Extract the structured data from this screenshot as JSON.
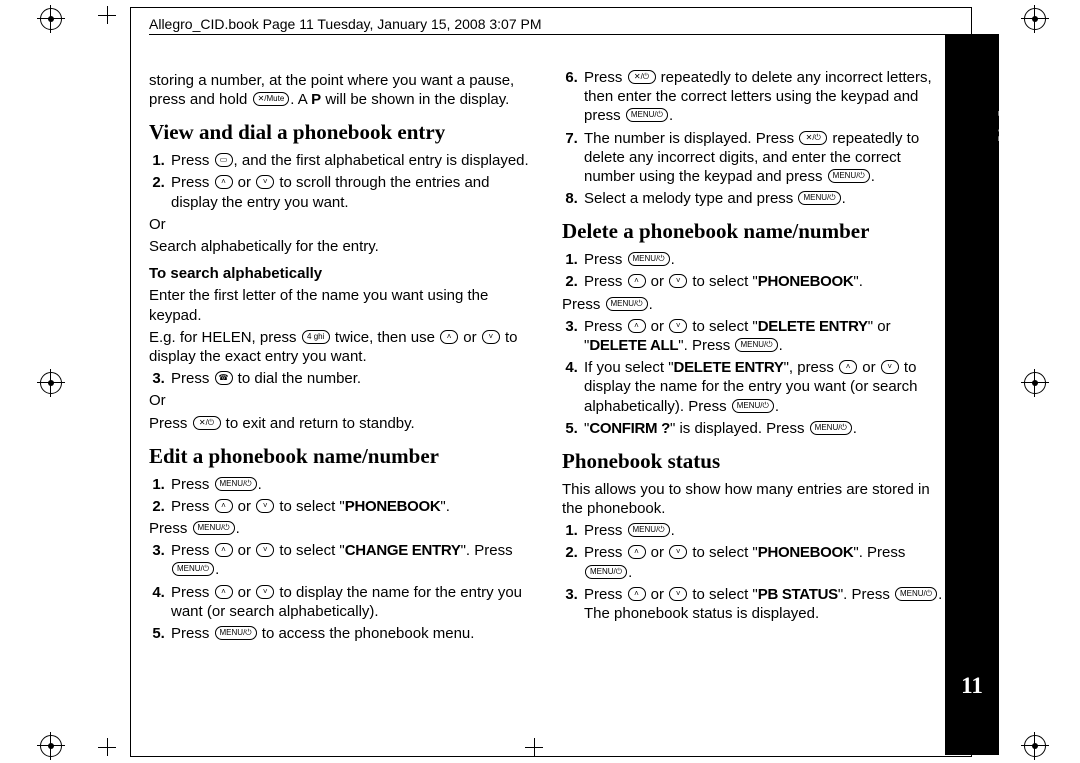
{
  "header": "Allegro_CID.book  Page 11  Tuesday, January 15, 2008  3:07 PM",
  "tab": {
    "lang": "English",
    "page": "11"
  },
  "keys": {
    "menu": "MENU/⏻",
    "mute": "✕/Mute",
    "cancel": "✕/⏻",
    "four": "4 ghi",
    "book": "▭",
    "talk": "☎",
    "up": "˄",
    "down": "˅"
  },
  "intro": {
    "a": "storing a number, at the point where you want a pause, press and hold ",
    "b": ". A ",
    "p": "P",
    "c": " will be shown in the display."
  },
  "h1": "View and dial a phonebook entry",
  "s1_1a": "Press ",
  "s1_1b": ", and the first alphabetical entry is displayed.",
  "s1_2a": "Press ",
  "s1_2b": " or ",
  "s1_2c": " to scroll through the entries and display the entry you want.",
  "s1_or": "Or",
  "s1_search": "Search alphabetically for the entry.",
  "s1_hdr": "To search alphabetically",
  "s1_p1": "Enter the first letter of the name you want using the keypad.",
  "s1_p2a": "E.g. for HELEN, press ",
  "s1_p2b": " twice, then use ",
  "s1_p2c": " or ",
  "s1_p2d": " to display the exact entry you want.",
  "s1_3a": "Press ",
  "s1_3b": " to dial the number.",
  "s1_p3a": "Press ",
  "s1_p3b": " to exit and return to standby.",
  "h2": "Edit a phonebook name/number",
  "s2_1": "Press ",
  "s2_2a": "Press ",
  "s2_2b": " or ",
  "s2_2c": " to select \"",
  "s2_2d": "PHONEBOOK",
  "s2_2e": "\".",
  "s2_press": "Press ",
  "s2_3a": "Press ",
  "s2_3b": " or ",
  "s2_3c": " to select \"",
  "s2_3d": "CHANGE ENTRY",
  "s2_3e": "\". Press ",
  "s2_4a": "Press ",
  "s2_4b": " or ",
  "s2_4c": " to display the name for the entry you want (or search alphabetically).",
  "s2_5a": "Press ",
  "s2_5b": " to access the phonebook menu.",
  "s2_6a": "Press ",
  "s2_6b": " repeatedly to delete any incorrect letters, then enter the correct letters using the keypad and press ",
  "s2_7a": "The number is displayed. Press ",
  "s2_7b": " repeatedly to delete any incorrect digits, and enter the correct number using the keypad and press ",
  "s2_8a": "Select a melody type and press ",
  "h3": "Delete a phonebook name/number",
  "s3_1": "Press ",
  "s3_2a": "Press ",
  "s3_2b": " or ",
  "s3_2c": " to select \"",
  "s3_2d": "PHONEBOOK",
  "s3_2e": "\".",
  "s3_press": "Press ",
  "s3_3a": "Press ",
  "s3_3b": " or ",
  "s3_3c": " to select \"",
  "s3_3d": "DELETE ENTRY",
  "s3_3e": "\" or \"",
  "s3_3f": "DELETE ALL",
  "s3_3g": "\". Press ",
  "s3_4a": "If you select \"",
  "s3_4b": "DELETE ENTRY",
  "s3_4c": "\", press ",
  "s3_4d": " or ",
  "s3_4e": " to display the name for the entry you want (or search alphabetically). Press ",
  "s3_5a": "\"",
  "s3_5b": "CONFIRM ?",
  "s3_5c": "\" is displayed. Press ",
  "h4": "Phonebook status",
  "s4_p": "This allows you to show how many entries are stored in the phonebook.",
  "s4_1": "Press ",
  "s4_2a": "Press ",
  "s4_2b": " or ",
  "s4_2c": " to select \"",
  "s4_2d": "PHONEBOOK",
  "s4_2e": "\". Press ",
  "s4_3a": "Press ",
  "s4_3b": " or ",
  "s4_3c": " to select \"",
  "s4_3d": "PB STATUS",
  "s4_3e": "\". Press ",
  "s4_3f": ". The phonebook status is displayed."
}
